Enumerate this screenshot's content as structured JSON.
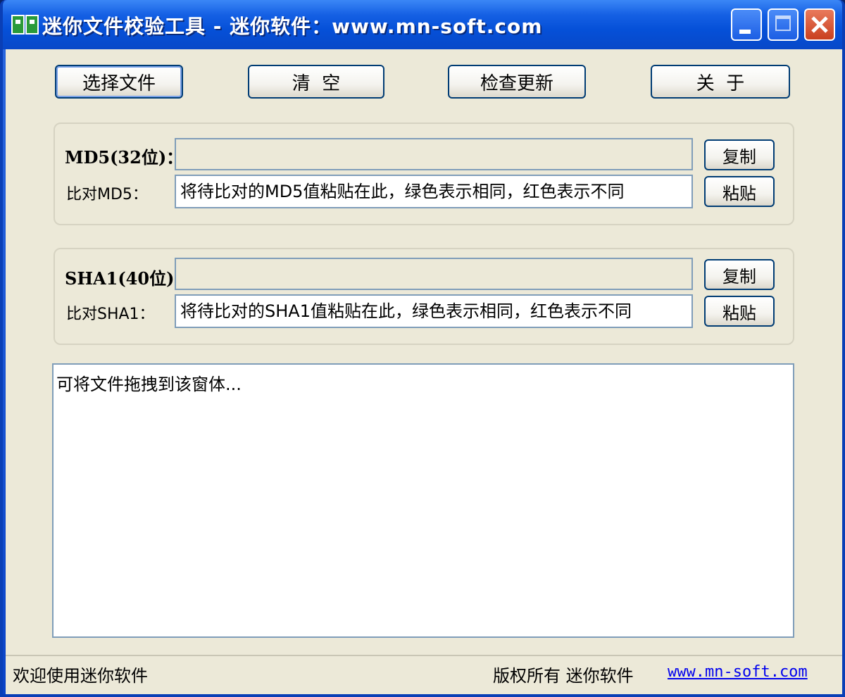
{
  "window": {
    "title": "迷你文件校验工具 - 迷你软件：www.mn-soft.com"
  },
  "toolbar": {
    "select_file": "选择文件",
    "clear": "清  空",
    "check_update": "检查更新",
    "about": "关  于"
  },
  "md5": {
    "label": "MD5(32位)：",
    "value": "",
    "copy_label": "复制",
    "compare_label": "比对MD5：",
    "compare_value": "将待比对的MD5值粘贴在此，绿色表示相同，红色表示不同",
    "paste_label": "粘贴"
  },
  "sha1": {
    "label": "SHA1(40位)",
    "value": "",
    "copy_label": "复制",
    "compare_label": "比对SHA1：",
    "compare_value": "将待比对的SHA1值粘贴在此，绿色表示相同，红色表示不同",
    "paste_label": "粘贴"
  },
  "log": {
    "text": "可将文件拖拽到该窗体..."
  },
  "status": {
    "left": "欢迎使用迷你软件",
    "copyright": "版权所有 迷你软件",
    "link": "www.mn-soft.com"
  },
  "colors": {
    "titlebar": "#0550d8",
    "client": "#ece9d8",
    "link": "#0000ee"
  }
}
